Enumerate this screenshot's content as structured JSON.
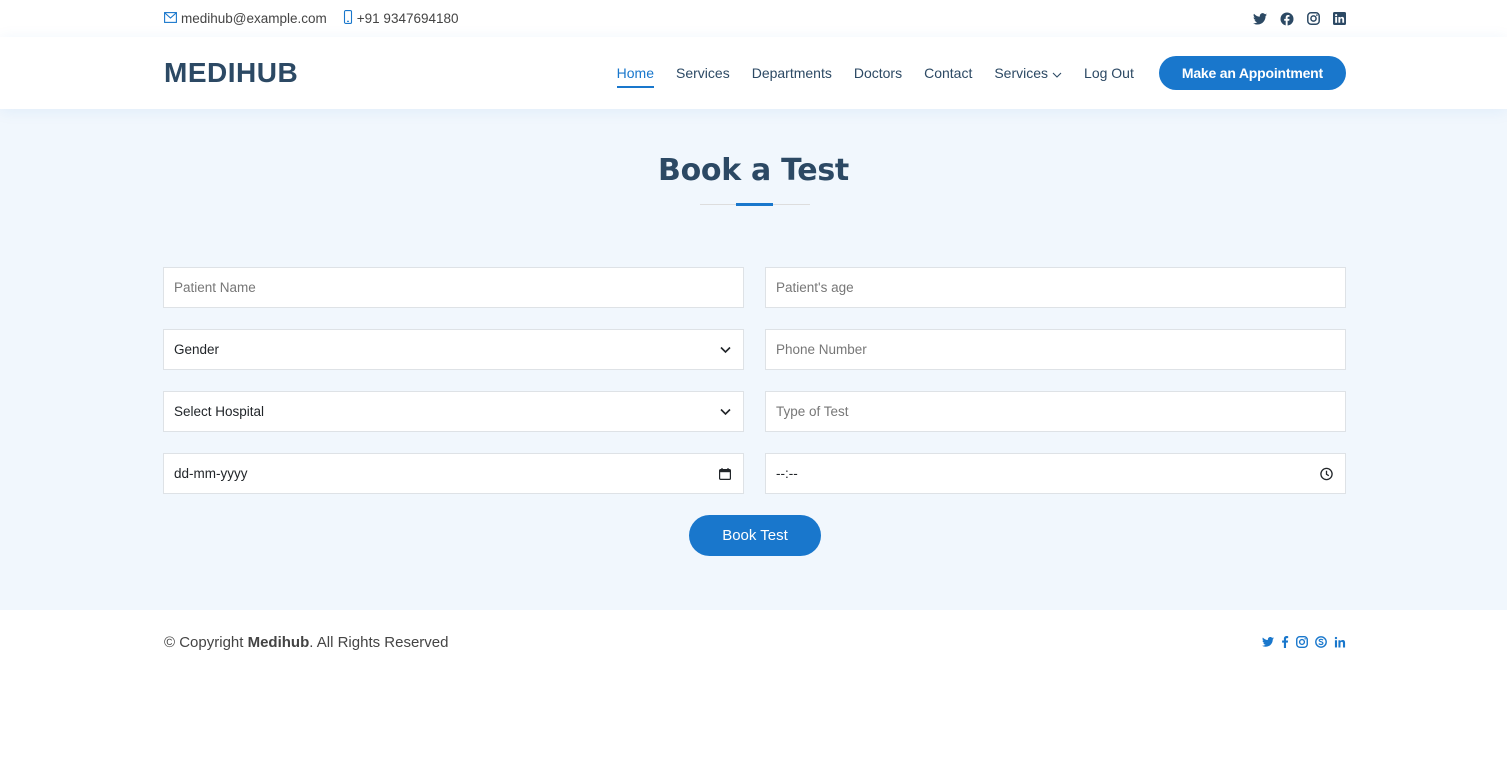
{
  "colors": {
    "accent": "#1977cc",
    "heading": "#2c4964",
    "section_bg": "#f1f7fd"
  },
  "topbar": {
    "email": "medihub@example.com",
    "phone": "+91 9347694180",
    "social_icons": [
      "twitter-icon",
      "facebook-icon",
      "instagram-icon",
      "linkedin-icon"
    ]
  },
  "header": {
    "logo": "MEDIHUB",
    "nav": [
      {
        "label": "Home",
        "active": true
      },
      {
        "label": "Services"
      },
      {
        "label": "Departments"
      },
      {
        "label": "Doctors"
      },
      {
        "label": "Contact"
      },
      {
        "label": "Services",
        "dropdown": true
      },
      {
        "label": "Log Out"
      }
    ],
    "cta": "Make an Appointment"
  },
  "form": {
    "title": "Book a Test",
    "patient_name_placeholder": "Patient Name",
    "patient_age_placeholder": "Patient's age",
    "gender_value": "Gender",
    "phone_placeholder": "Phone Number",
    "hospital_value": "Select Hospital",
    "test_type_placeholder": "Type of Test",
    "date_value": "dd-mm-yyyy",
    "time_value": "--:--",
    "submit_label": "Book Test"
  },
  "footer": {
    "copyright_prefix": "© Copyright ",
    "copyright_brand": "Medihub",
    "copyright_suffix": ". All Rights Reserved",
    "social_icons": [
      "twitter-icon",
      "facebook-icon",
      "instagram-icon",
      "skype-icon",
      "linkedin-icon"
    ]
  }
}
